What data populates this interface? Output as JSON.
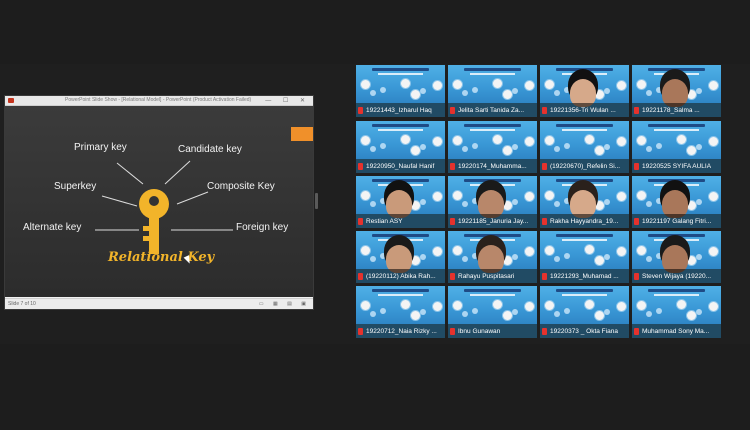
{
  "shared_window": {
    "title": "PowerPoint Slide Show - [Relational Model] - PowerPoint (Product Activation Failed)",
    "status": "Slide 7 of 10",
    "win_controls": "— ☐ ✕"
  },
  "slide": {
    "labels": {
      "primary": "Primary key",
      "candidate": "Candidate key",
      "superkey": "Superkey",
      "composite": "Composite Key",
      "alternate": "Alternate key",
      "foreign": "Foreign key"
    },
    "center": "Relational Key",
    "accent": "#f2b42a",
    "tab_color": "#f0902a"
  },
  "participants": [
    {
      "name": "19221443_Izharul Haq",
      "video": false
    },
    {
      "name": "Jelita Sarti Tanida Za...",
      "video": false
    },
    {
      "name": "19221356-Tri Wulan ...",
      "video": true
    },
    {
      "name": "19221178_Salma ...",
      "video": true
    },
    {
      "name": "19220950_Naufal Hanif",
      "video": false
    },
    {
      "name": "19220174_Muhamma...",
      "video": false
    },
    {
      "name": "(19220670)_Refelin Si...",
      "video": false
    },
    {
      "name": "19220525 SYIFA AULIA",
      "video": false
    },
    {
      "name": "Restian ASY",
      "video": true
    },
    {
      "name": "19221185_Januria Jay...",
      "video": true
    },
    {
      "name": "Rakha Hayyandra_19...",
      "video": true
    },
    {
      "name": "19221197 Galang Fitri...",
      "video": true
    },
    {
      "name": "(19220112) Abika Rah...",
      "video": true
    },
    {
      "name": "Rahayu Puspitasari",
      "video": true
    },
    {
      "name": "19221293_Muhamad ...",
      "video": false
    },
    {
      "name": "Steven Wijaya (19220...",
      "video": true
    },
    {
      "name": "19220712_Naia Rizky ...",
      "video": false
    },
    {
      "name": "Ibnu Gunawan",
      "video": false
    },
    {
      "name": "19220373 _ Okta Fiana",
      "video": false
    },
    {
      "name": "Muhammad Sony Ma...",
      "video": false
    }
  ],
  "icons": {
    "mic": "mic-muted-icon",
    "app": "powerpoint-icon"
  },
  "colors": {
    "banner": "#4aa7de",
    "label_bar": "#000000",
    "mic": "#e5322d"
  }
}
